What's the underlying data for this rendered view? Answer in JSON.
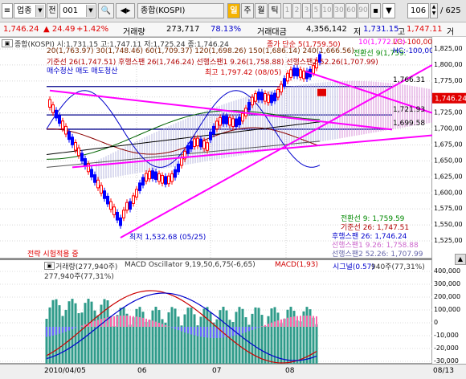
{
  "toolbar": {
    "market": "업종",
    "tab_label": "전",
    "code": "001",
    "name": "종합(KOSPI)",
    "period_buttons": [
      "일",
      "주",
      "월",
      "틱"
    ],
    "minute_buttons": [
      "1",
      "2",
      "3",
      "5",
      "10",
      "30",
      "60",
      "90"
    ],
    "count": "106",
    "total": "/ 625"
  },
  "infobar": {
    "price": "1,746.24",
    "change": "▲ 24.49",
    "change_pct": "+1.42%",
    "volume_label": "거래량",
    "volume": "273,717",
    "volume_ratio": "78.13%",
    "amount_label": "거래대금",
    "amount": "4,356,142",
    "low_label": "저",
    "low": "1,731.15",
    "high_label": "고",
    "high": "1,747.11",
    "extra_label": "거"
  },
  "price_legend": {
    "line1": "종합(KOSPI) 시:1,731.15 고:1,747.11 저:1,725.24 종:1,746.24",
    "line1b": "종가 단순 5(1,759.50)",
    "line1c": "10(1,772.73)",
    "line2": "20(1,763.97) 30(1,748.46) 60(1,709.37) 120(1,698.26) 150(1,686.14) 240(1,666.56)",
    "line2b": "전환선 9(1,759.",
    "line3": "기준선 26(1,747.51) 후행스팬 26(1,746.24) 선행스팬1 9.26(1,758.88) 선행스팬2 52.26(1,707.99)",
    "line4": "매수청산 매도 매도청산",
    "right1": "LC:-100,00",
    "right2": "HC:-100,00",
    "high_note": "최고 1,797.42 (08/05)",
    "low_note": "최저 1,532.68 (05/25)",
    "hline1": "1,766.31",
    "hline2": "1,721.93",
    "hline3": "1,699.58",
    "lower_legend": [
      "전환선 9: 1,759.59",
      "기준선 26: 1,747.51",
      "후행스팬 26: 1,746.24",
      "선행스팬1 9.26: 1,758.88",
      "선행스팬2 52.26: 1,707.99"
    ],
    "strategy": "전략 시험적용 중"
  },
  "price_axis": {
    "ticks": [
      "1,825,00",
      "1,800,00",
      "1,775,00",
      "1,750,00",
      "1,725,00",
      "1,700,00",
      "1,675,00",
      "1,650,00",
      "1,625,00",
      "1,600,00",
      "1,575,00",
      "1,550,00",
      "1,525,00"
    ],
    "current": "1,746.24"
  },
  "osc_legend": {
    "line1a": "거래량(277,940주)",
    "line1b": "MACD Oscillator 9,19,50,6,75(-6,65)",
    "line1c": "MACD(1,93)",
    "line1d": "시그널(0.57)",
    "line1e": "940주(77,31%)",
    "line2": "277,940주(77,31%)"
  },
  "osc_axis": {
    "ticks": [
      "400,000",
      "300,000",
      "200,000",
      "100,000",
      "0",
      "-10,000",
      "-20,000",
      "-30,000"
    ]
  },
  "date_axis": {
    "labels": [
      "2010/04/05",
      "06",
      "07",
      "08"
    ],
    "last": "08/13"
  },
  "colors": {
    "candle_up": "#ff0000",
    "candle_down": "#0000ff",
    "trendline": "#ff00ff",
    "volume_bar": "#2f9b8a",
    "toolbar_bg": "#e4e4e4",
    "selected_tab": "#f5b300"
  }
}
